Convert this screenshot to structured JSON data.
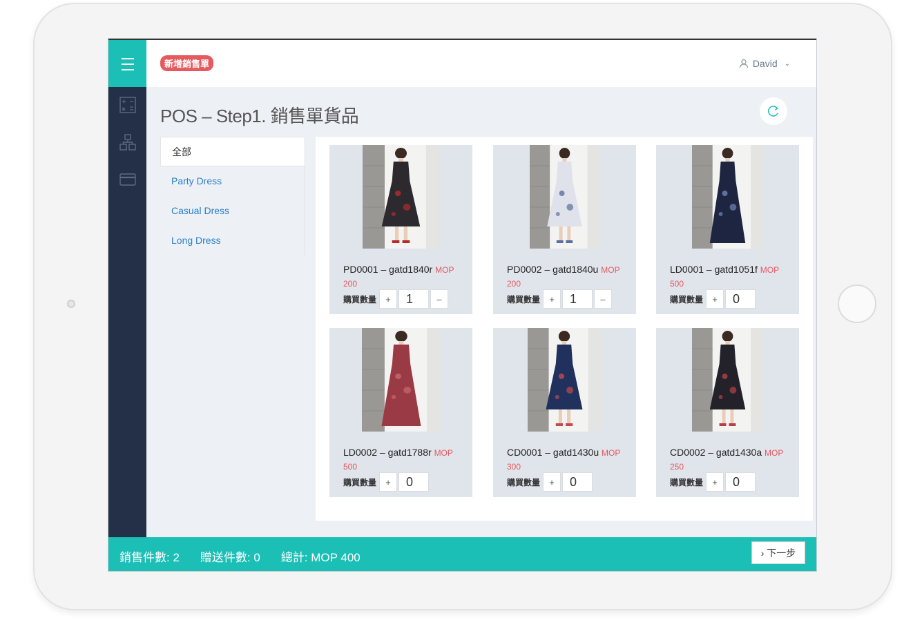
{
  "header": {
    "badge": "新增銷售單",
    "user": "David"
  },
  "page": {
    "title": "POS – Step1. 銷售單貨品"
  },
  "categories": [
    "全部",
    "Party Dress",
    "Casual Dress",
    "Long Dress"
  ],
  "qty_label": "購買數量",
  "products": [
    {
      "code": "PD0001 – gatd1840r",
      "price": "MOP 200",
      "qty": "1",
      "dress_color": "#2c2a2e",
      "accent": "#b52a2e"
    },
    {
      "code": "PD0002 – gatd1840u",
      "price": "MOP 200",
      "qty": "1",
      "dress_color": "#dfe2ea",
      "accent": "#5a6fa0"
    },
    {
      "code": "LD0001 – gatd1051f",
      "price": "MOP 500",
      "qty": "0",
      "dress_color": "#1e2540",
      "accent": "#6e85b8"
    },
    {
      "code": "LD0002 – gatd1788r",
      "price": "MOP 500",
      "qty": "0",
      "dress_color": "#9a3a44",
      "accent": "#c46a70"
    },
    {
      "code": "CD0001 – gatd1430u",
      "price": "MOP 300",
      "qty": "0",
      "dress_color": "#20315e",
      "accent": "#c24a4a"
    },
    {
      "code": "CD0002 – gatd1430a",
      "price": "MOP 250",
      "qty": "0",
      "dress_color": "#23222a",
      "accent": "#b54048"
    }
  ],
  "footer": {
    "sold": "銷售件數: 2",
    "gift": "贈送件數: 0",
    "total": "總計: MOP 400",
    "next": "› 下一步"
  },
  "colors": {
    "brand": "#1bbfb6",
    "nav": "#243048",
    "price": "#e55a5f"
  }
}
